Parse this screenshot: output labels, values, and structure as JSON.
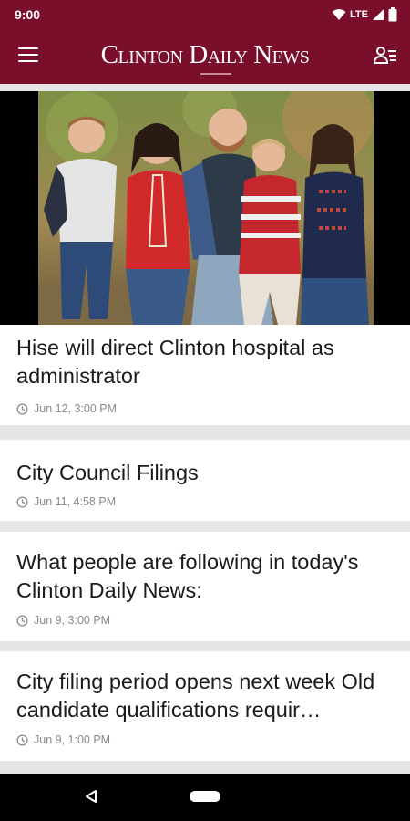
{
  "status_bar": {
    "time": "9:00",
    "network": "LTE"
  },
  "app_bar": {
    "title": "Clinton Daily News"
  },
  "articles": [
    {
      "title": "Hise will direct Clinton hospital as administrator",
      "meta": "Jun 12, 3:00 PM"
    },
    {
      "title": "City Council Filings",
      "meta": "Jun 11, 4:58 PM"
    },
    {
      "title": "What people are following in today's Clinton Daily News:",
      "meta": "Jun 9, 3:00 PM"
    },
    {
      "title": "City filing period opens next week Old candidate qualifications requir…",
      "meta": "Jun 9, 1:00 PM"
    }
  ],
  "colors": {
    "brand": "#7a0f2b",
    "card": "#ffffff",
    "divider": "#e6e6e6",
    "meta": "#8a8a8a"
  },
  "icons": [
    "wifi-icon",
    "signal-icon",
    "battery-icon",
    "menu-icon",
    "account-list-icon",
    "clock-icon",
    "back-icon",
    "home-pill-icon"
  ]
}
